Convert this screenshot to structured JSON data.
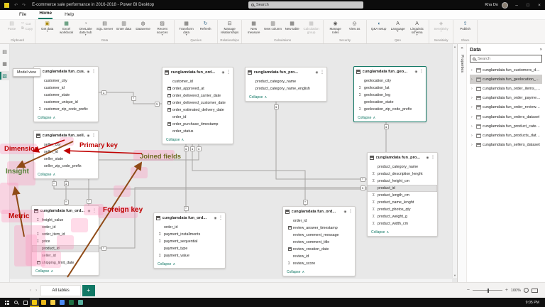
{
  "titlebar": {
    "title": "E-commerce sale performance in 2016-2018 - Power BI Desktop",
    "search_placeholder": "Search",
    "user_name": "Kha Do",
    "minimize_glyph": "–",
    "maximize_glyph": "□",
    "close_glyph": "×"
  },
  "menu": {
    "items": [
      {
        "label": "File"
      },
      {
        "label": "Home",
        "active": true
      },
      {
        "label": "Help"
      }
    ]
  },
  "ribbon": {
    "groups": [
      {
        "label": "Clipboard",
        "buttons": [
          {
            "label": "Paste",
            "icon": "paste-icon",
            "big": true,
            "disabled": true
          },
          {
            "label": "Cut",
            "icon": "cut-icon",
            "disabled": true
          },
          {
            "label": "Copy",
            "icon": "copy-icon",
            "disabled": true
          }
        ]
      },
      {
        "label": "Data",
        "buttons": [
          {
            "label": "Get data",
            "icon": "get-data-icon",
            "big": true,
            "caret": true
          },
          {
            "label": "Excel workbook",
            "icon": "excel-icon",
            "big": true
          },
          {
            "label": "OneLake data hub",
            "icon": "onelake-icon",
            "big": true,
            "caret": true
          },
          {
            "label": "SQL Server",
            "icon": "sql-server-icon",
            "big": true
          },
          {
            "label": "Enter data",
            "icon": "enter-data-icon",
            "big": true
          },
          {
            "label": "Dataverse",
            "icon": "dataverse-icon",
            "big": true
          },
          {
            "label": "Recent sources",
            "icon": "recent-sources-icon",
            "big": true,
            "caret": true
          }
        ]
      },
      {
        "label": "Queries",
        "buttons": [
          {
            "label": "Transform data",
            "icon": "transform-data-icon",
            "big": true,
            "caret": true
          },
          {
            "label": "Refresh",
            "icon": "refresh-icon",
            "big": true
          }
        ]
      },
      {
        "label": "Relationships",
        "buttons": [
          {
            "label": "Manage relationships",
            "icon": "manage-relationships-icon",
            "big": true
          }
        ]
      },
      {
        "label": "Calculations",
        "buttons": [
          {
            "label": "New measure",
            "icon": "new-measure-icon",
            "big": true
          },
          {
            "label": "New column",
            "icon": "new-column-icon",
            "big": true
          },
          {
            "label": "New table",
            "icon": "new-table-icon",
            "big": true
          },
          {
            "label": "Calculation group",
            "icon": "calculation-group-icon",
            "big": true,
            "disabled": true
          }
        ]
      },
      {
        "label": "Security",
        "buttons": [
          {
            "label": "Manage roles",
            "icon": "manage-roles-icon",
            "big": true
          },
          {
            "label": "View as",
            "icon": "view-as-icon",
            "big": true
          }
        ]
      },
      {
        "label": "Q&A",
        "buttons": [
          {
            "label": "Q&A setup",
            "icon": "qa-setup-icon",
            "big": true
          },
          {
            "label": "Language",
            "icon": "language-icon",
            "big": true,
            "caret": true
          },
          {
            "label": "Linguistic schema",
            "icon": "linguistic-schema-icon",
            "big": true,
            "caret": true
          }
        ]
      },
      {
        "label": "Sensitivity",
        "buttons": [
          {
            "label": "Sensitivity",
            "icon": "sensitivity-icon",
            "big": true,
            "disabled": true,
            "caret": true
          }
        ]
      },
      {
        "label": "Share",
        "buttons": [
          {
            "label": "Publish",
            "icon": "publish-icon",
            "big": true
          }
        ]
      }
    ]
  },
  "view_rail": {
    "tooltip": "Model view",
    "views": [
      {
        "name": "report-view"
      },
      {
        "name": "table-view"
      },
      {
        "name": "model-view",
        "active": true
      }
    ]
  },
  "canvas": {
    "tables": [
      {
        "id": "customers",
        "name": "cunglamdata fun_cus...",
        "collapse_label": "Collapse",
        "fields": [
          {
            "name": "customer_city",
            "type": "text"
          },
          {
            "name": "customer_id",
            "type": "text"
          },
          {
            "name": "customer_state",
            "type": "text"
          },
          {
            "name": "customer_unique_id",
            "type": "text"
          },
          {
            "name": "customer_zip_code_prefix",
            "type": "sum"
          }
        ]
      },
      {
        "id": "orders",
        "name": "cunglamdata fun_ord...",
        "collapse_label": "Collapse",
        "fields": [
          {
            "name": "customer_id",
            "type": "text"
          },
          {
            "name": "order_approved_at",
            "type": "date"
          },
          {
            "name": "order_delivered_carrier_date",
            "type": "date"
          },
          {
            "name": "order_delivered_customer_date",
            "type": "date"
          },
          {
            "name": "order_estimated_delivery_date",
            "type": "date"
          },
          {
            "name": "order_id",
            "type": "text"
          },
          {
            "name": "order_purchase_timestamp",
            "type": "date"
          },
          {
            "name": "order_status",
            "type": "text"
          }
        ]
      },
      {
        "id": "category",
        "name": "cunglamdata fun_pro...",
        "collapse_label": "Collapse",
        "fields": [
          {
            "name": "product_category_name",
            "type": "text"
          },
          {
            "name": "product_category_name_english",
            "type": "text"
          }
        ]
      },
      {
        "id": "geolocation",
        "name": "cunglamdata fun_geo...",
        "selected": true,
        "collapse_label": "Collapse",
        "fields": [
          {
            "name": "geolocation_city",
            "type": "text"
          },
          {
            "name": "geolocation_lat",
            "type": "sum"
          },
          {
            "name": "geolocation_lng",
            "type": "sum"
          },
          {
            "name": "geolocation_state",
            "type": "text"
          },
          {
            "name": "geolocation_zip_code_prefix",
            "type": "sum"
          }
        ]
      },
      {
        "id": "sellers",
        "name": "cunglamdata fun_sell...",
        "collapse_label": "Collapse",
        "fields": [
          {
            "name": "seller_city",
            "type": "text"
          },
          {
            "name": "seller_id",
            "type": "text"
          },
          {
            "name": "seller_state",
            "type": "text"
          },
          {
            "name": "seller_zip_code_prefix",
            "type": "text"
          }
        ]
      },
      {
        "id": "order_items",
        "name": "cunglamdata fun_ord...",
        "collapse_label": "Collapse",
        "fields": [
          {
            "name": "freight_value",
            "type": "sum"
          },
          {
            "name": "order_id",
            "type": "text"
          },
          {
            "name": "order_item_id",
            "type": "sum"
          },
          {
            "name": "price",
            "type": "sum"
          },
          {
            "name": "product_id",
            "type": "text",
            "selected": true
          },
          {
            "name": "seller_id",
            "type": "text"
          },
          {
            "name": "shipping_limit_date",
            "type": "date"
          }
        ]
      },
      {
        "id": "payments",
        "name": "cunglamdata fun_ord...",
        "collapse_label": "Collapse",
        "fields": [
          {
            "name": "order_id",
            "type": "text"
          },
          {
            "name": "payment_installments",
            "type": "sum"
          },
          {
            "name": "payment_sequential",
            "type": "sum"
          },
          {
            "name": "payment_type",
            "type": "text"
          },
          {
            "name": "payment_value",
            "type": "sum"
          }
        ]
      },
      {
        "id": "reviews",
        "name": "cunglamdata fun_ord...",
        "collapse_label": "Collapse",
        "fields": [
          {
            "name": "order_id",
            "type": "text"
          },
          {
            "name": "review_answer_timestamp",
            "type": "date"
          },
          {
            "name": "review_comment_message",
            "type": "text"
          },
          {
            "name": "review_comment_title",
            "type": "text"
          },
          {
            "name": "review_creation_date",
            "type": "date"
          },
          {
            "name": "review_id",
            "type": "text"
          },
          {
            "name": "review_score",
            "type": "sum"
          }
        ]
      },
      {
        "id": "products",
        "name": "cunglamdata fun_pro...",
        "collapse_label": "Collapse",
        "fields": [
          {
            "name": "product_category_name",
            "type": "text"
          },
          {
            "name": "product_description_lenght",
            "type": "sum"
          },
          {
            "name": "product_height_cm",
            "type": "sum"
          },
          {
            "name": "product_id",
            "type": "text",
            "selected": true
          },
          {
            "name": "product_length_cm",
            "type": "sum"
          },
          {
            "name": "product_name_lenght",
            "type": "sum"
          },
          {
            "name": "product_photos_qty",
            "type": "sum"
          },
          {
            "name": "product_weight_g",
            "type": "sum"
          },
          {
            "name": "product_width_cm",
            "type": "sum"
          }
        ]
      }
    ],
    "relationships": [
      {
        "badges": [
          "1",
          "*",
          "1"
        ]
      },
      {
        "badges": [
          "1",
          "*"
        ]
      },
      {
        "badges": [
          "1",
          "*"
        ]
      },
      {
        "badges": [
          "1",
          "*"
        ]
      },
      {
        "badges": [
          "1",
          "*"
        ]
      },
      {
        "badges": [
          "1",
          "*"
        ]
      },
      {
        "badges": [
          "1",
          "*"
        ]
      },
      {
        "badges": [
          "*",
          "1"
        ]
      }
    ]
  },
  "annotations": {
    "labels": [
      {
        "text": "Dimension",
        "color": "#c00000"
      },
      {
        "text": "Primary key",
        "color": "#c00000"
      },
      {
        "text": "Joined fields",
        "color": "#6d6b21"
      },
      {
        "text": "Insight",
        "color": "#538135"
      },
      {
        "text": "Metric",
        "color": "#c00000"
      },
      {
        "text": "Foreign key",
        "color": "#c00000"
      }
    ]
  },
  "data_panel": {
    "title": "Data",
    "expand_icon": "»",
    "collapse_icon": "«",
    "properties_label": "Properties",
    "search_placeholder": "Search",
    "items": [
      {
        "name": "cunglamdata fun_customers_dataset"
      },
      {
        "name": "cunglamdata fun_geolocation_dataset",
        "selected": true
      },
      {
        "name": "cunglamdata fun_order_items_dataset"
      },
      {
        "name": "cunglamdata fun_order_payments_dataset"
      },
      {
        "name": "cunglamdata fun_order_reviews_dataset"
      },
      {
        "name": "cunglamdata fun_orders_dataset"
      },
      {
        "name": "cunglamdata fun_product_category_name..."
      },
      {
        "name": "cunglamdata fun_products_dataset"
      },
      {
        "name": "cunglamdata fun_sellers_dataset"
      }
    ]
  },
  "footer": {
    "tabs": [
      {
        "label": "All tables",
        "active": true
      }
    ],
    "add_tab_icon": "+",
    "zoom_out": "−",
    "zoom_in": "+",
    "zoom_level": "100%"
  },
  "taskbar": {
    "time": "9:05 PM",
    "apps": [
      {
        "name": "powerbi-desktop",
        "color": "#f2c811",
        "active": true
      },
      {
        "name": "sticky-notes",
        "color": "#e8b71a"
      },
      {
        "name": "file-explorer",
        "color": "#f7ce46"
      },
      {
        "name": "web-browser",
        "color": "#4c8bf5"
      },
      {
        "name": "excel",
        "color": "#1d6f42"
      },
      {
        "name": "media-app",
        "color": "#59b0a0"
      }
    ]
  }
}
